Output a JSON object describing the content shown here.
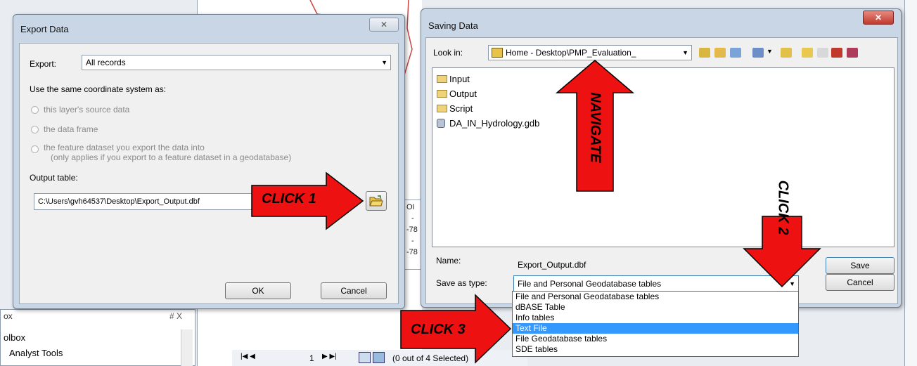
{
  "export_dialog": {
    "title": "Export Data",
    "export_label": "Export:",
    "export_value": "All records",
    "coord_heading": "Use the same coordinate system as:",
    "options": [
      "this layer's source data",
      "the data frame",
      "the feature dataset you export the data into",
      "(only applies if you export to a feature dataset in a geodatabase)"
    ],
    "output_label": "Output table:",
    "output_value": "C:\\Users\\gvh64537\\Desktop\\Export_Output.dbf",
    "ok_label": "OK",
    "cancel_label": "Cancel"
  },
  "saving_dialog": {
    "title": "Saving Data",
    "look_in_label": "Look in:",
    "look_in_value": "Home - Desktop\\PMP_Evaluation_",
    "items": [
      "Input",
      "Output",
      "Script",
      "DA_IN_Hydrology.gdb"
    ],
    "name_label": "Name:",
    "name_value": "Export_Output.dbf",
    "type_label": "Save as type:",
    "type_value": "File and Personal Geodatabase tables",
    "save_label": "Save",
    "cancel_label": "Cancel",
    "type_options": [
      "File and Personal Geodatabase tables",
      "dBASE Table",
      "Info tables",
      "Text File",
      "File Geodatabase tables",
      "SDE tables"
    ],
    "selected_option_index": 3
  },
  "annotations": {
    "click1": "CLICK 1",
    "click2": "CLICK 2",
    "click3": "CLICK 3",
    "navigate": "NAVIGATE"
  },
  "background": {
    "toolbox_title": "ox",
    "toolbox_root": "olbox",
    "toolbox_item": "Analyst Tools",
    "pin": "# X",
    "page_number": "1",
    "selection_status": "(0 out of 4 Selected)",
    "table_header": "OI",
    "table_cells": [
      "-",
      "-78",
      "-",
      "-78"
    ]
  },
  "colors": {
    "arrow_fill": "#ee1111",
    "selection": "#3399ff",
    "dialog_frame": "#c9d6e6"
  }
}
